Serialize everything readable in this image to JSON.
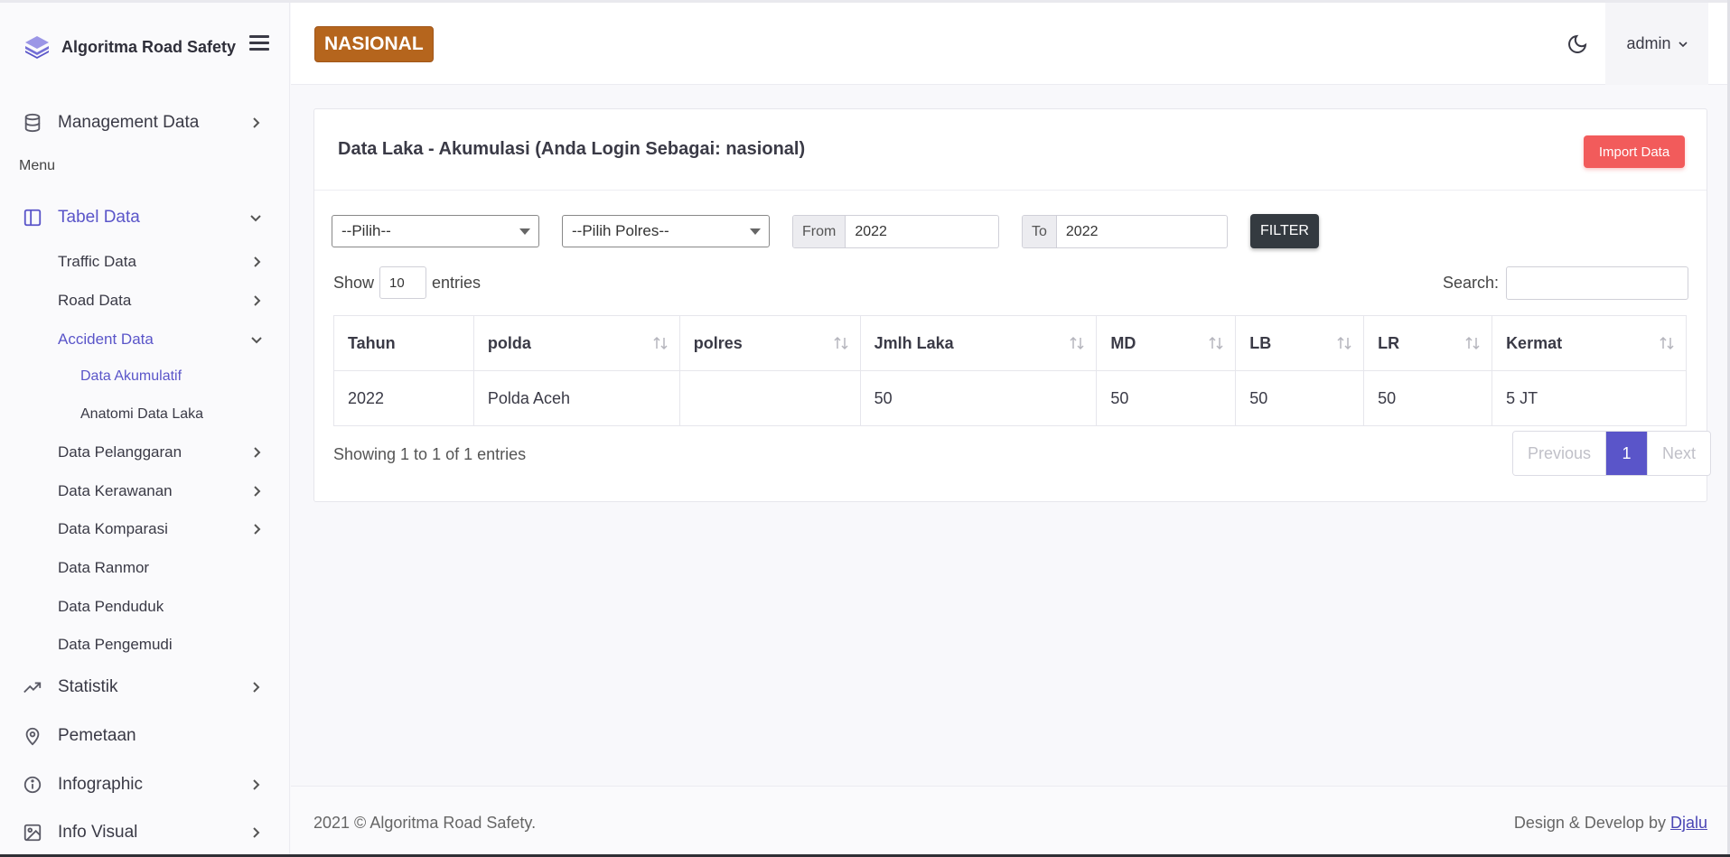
{
  "brand": {
    "name": "Algoritma Road Safety"
  },
  "header": {
    "badge": "NASIONAL",
    "user": "admin"
  },
  "sidebar": {
    "management": "Management Data",
    "menu_label": "Menu",
    "tabel_data": "Tabel Data",
    "sub": {
      "traffic": "Traffic Data",
      "road": "Road Data",
      "accident": "Accident Data",
      "akumulatif": "Data Akumulatif",
      "anatomi": "Anatomi Data Laka",
      "pelanggaran": "Data Pelanggaran",
      "kerawanan": "Data Kerawanan",
      "komparasi": "Data Komparasi",
      "ranmor": "Data Ranmor",
      "penduduk": "Data Penduduk",
      "pengemudi": "Data Pengemudi"
    },
    "statistik": "Statistik",
    "pemetaan": "Pemetaan",
    "infographic": "Infographic",
    "info_visual": "Info Visual"
  },
  "card": {
    "title": "Data Laka - Akumulasi (Anda Login Sebagai: nasional)",
    "import_label": "Import Data",
    "filters": {
      "polda": "--Pilih--",
      "polres": "--Pilih Polres--",
      "from_label": "From",
      "from_value": "2022",
      "to_label": "To",
      "to_value": "2022",
      "filter_label": "FILTER"
    },
    "show_label": "Show",
    "show_value": "10",
    "entries_label": "entries",
    "search_label": "Search:",
    "columns": [
      "Tahun",
      "polda",
      "polres",
      "Jmlh Laka",
      "MD",
      "LB",
      "LR",
      "Kermat"
    ],
    "rows": [
      [
        "2022",
        "Polda Aceh",
        "",
        "50",
        "50",
        "50",
        "50",
        "5 JT"
      ]
    ],
    "info": "Showing 1 to 1 of 1 entries",
    "pager": {
      "prev": "Previous",
      "current": "1",
      "next": "Next"
    }
  },
  "footer": {
    "copyright": "2021 © Algoritma Road Safety.",
    "credit": "Design & Develop by",
    "credit_link": "Djalu"
  },
  "colors": {
    "accent": "#5a55c9",
    "badge": "#b5651d",
    "import": "#f25b5b",
    "filter": "#343a40"
  }
}
